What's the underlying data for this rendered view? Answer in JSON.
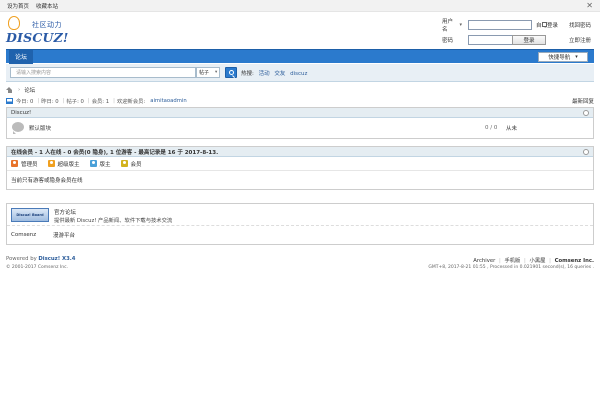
{
  "topbar": {
    "link1": "设为首页",
    "link2": "收藏本站",
    "close": "✕"
  },
  "logo": {
    "slogan": "社区动力",
    "word": "DISCUZ!"
  },
  "login": {
    "field1_label": "用户名",
    "field2_label": "密码",
    "remember_label": "自动登录",
    "forgot_label": "找回密码",
    "login_button": "登录",
    "register_label": "立即注册"
  },
  "nav": {
    "item": "论坛",
    "quick": "快捷导航"
  },
  "search": {
    "placeholder": "请输入搜索内容",
    "type": "帖子",
    "hot_label": "热搜:",
    "hot1": "活动",
    "hot2": "交友",
    "hot3": "discuz"
  },
  "crumb": {
    "current": "论坛"
  },
  "stats": {
    "today": "今日: 0",
    "yesterday": "昨日: 0",
    "posts": "帖子: 0",
    "members": "会员: 1",
    "newest_label": "欢迎新会员:",
    "newest_user": "aimitaoadmin",
    "right_link": "最新回复"
  },
  "forum_box": {
    "header": "Discuz!",
    "forum_name": "默认版块",
    "count": "0 / 0",
    "last": "从未"
  },
  "online": {
    "header": "在线会员 - 1 人在线 - 0 会员(0 隐身), 1 位游客 - 最高记录是 16 于 2017-8-13.",
    "legend": [
      {
        "label": "管理员",
        "color": "#e8732a"
      },
      {
        "label": "超级版主",
        "color": "#f0a020"
      },
      {
        "label": "版主",
        "color": "#4aa0d8"
      },
      {
        "label": "会员",
        "color": "#d2b21e"
      }
    ],
    "list_text": "当前只有游客或隐身会员在线"
  },
  "friend_links": {
    "banner_text": "Discuz! Board",
    "title": "官方论坛",
    "desc": "提供最新 Discuz! 产品新闻、软件下载与技术交流",
    "bottom_left": "Comsenz",
    "bottom_right": "漫游平台"
  },
  "footer": {
    "powered": "Powered by",
    "product": "Discuz! X3.4",
    "copyright": "© 2001-2017 Comsenz Inc.",
    "links": [
      "Archiver",
      "手机版",
      "小黑屋"
    ],
    "company": "Comsenz Inc.",
    "debug": "GMT+8, 2017-8-21 01:55 , Processed in 0.021901 second(s), 16 queries ."
  }
}
